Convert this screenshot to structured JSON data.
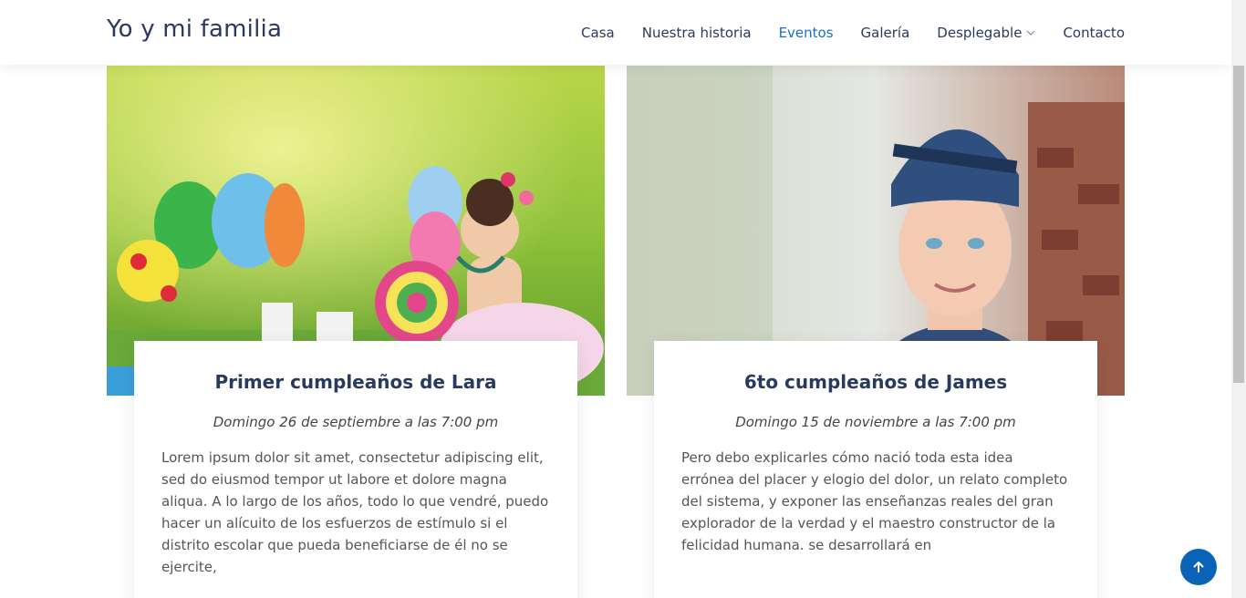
{
  "site": {
    "logo": "Yo y mi familia"
  },
  "nav": {
    "items": [
      {
        "label": "Casa",
        "active": false
      },
      {
        "label": "Nuestra historia",
        "active": false
      },
      {
        "label": "Eventos",
        "active": true
      },
      {
        "label": "Galería",
        "active": false
      },
      {
        "label": "Desplegable",
        "active": false,
        "has_dropdown": true
      },
      {
        "label": "Contacto",
        "active": false
      }
    ]
  },
  "events": [
    {
      "title": "Primer cumpleaños de Lara",
      "date": "Domingo 26 de septiembre a las 7:00 pm",
      "text": "Lorem ipsum dolor sit amet, consectetur adipiscing elit, sed do eiusmod tempor ut labore et dolore magna aliqua. A lo largo de los años, todo lo que vendré, puedo hacer un alícuito de los esfuerzos de estímulo si el distrito escolar que pueda beneficiarse de él no se ejercite,"
    },
    {
      "title": "6to cumpleaños de James",
      "date": "Domingo 15 de noviembre a las 7:00 pm",
      "text": "Pero debo explicarles cómo nació toda esta idea errónea del placer y elogio del dolor, un relato completo del sistema, y exponer las enseñanzas reales del gran explorador de la verdad y el maestro constructor de la felicidad humana. se desarrollará en"
    }
  ],
  "colors": {
    "primary": "#283a5e",
    "accent": "#1a6fc4",
    "back_to_top": "#0b63b8"
  },
  "icons": {
    "dropdown": "chevron-down-icon",
    "back_to_top": "arrow-up-icon"
  }
}
